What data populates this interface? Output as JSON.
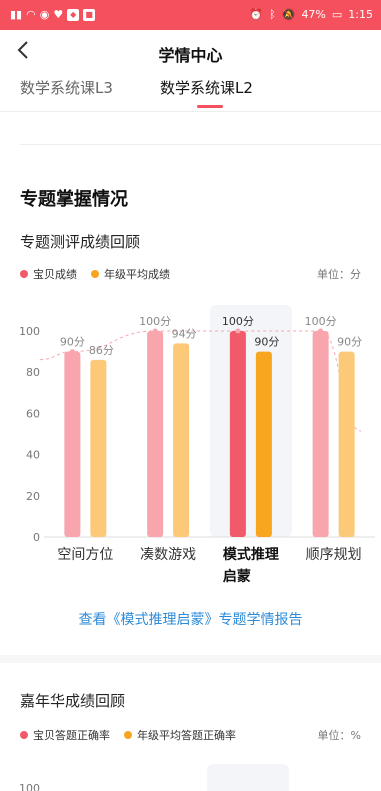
{
  "status": {
    "battery": "47%",
    "time": "1:15"
  },
  "header": {
    "title": "学情中心",
    "tabs": [
      "数学系统课L3",
      "数学系统课L2"
    ],
    "active_tab": 1
  },
  "section": {
    "title": "专题掌握情况"
  },
  "review1": {
    "title": "专题测评成绩回顾",
    "legend": [
      "宝贝成绩",
      "年级平均成绩"
    ],
    "unit": "单位：分",
    "link": "查看《模式推理启蒙》专题学情报告"
  },
  "review2": {
    "title": "嘉年华成绩回顾",
    "legend": [
      "宝贝答题正确率",
      "年级平均答题正确率"
    ],
    "unit": "单位：%"
  },
  "colors": {
    "accent": "#f4505e",
    "baby_light": "#f8a5ad",
    "baby_selected": "#f05a69",
    "avg_light": "#fcc979",
    "avg_selected": "#f8a51f",
    "link": "#2e8bd8"
  },
  "chart_data": [
    {
      "type": "bar",
      "title": "专题测评成绩回顾",
      "categories": [
        "空间方位",
        "凑数游戏",
        "模式推理启蒙",
        "顺序规划"
      ],
      "series": [
        {
          "name": "宝贝成绩",
          "values": [
            90,
            100,
            100,
            100
          ]
        },
        {
          "name": "年级平均成绩",
          "values": [
            86,
            94,
            90,
            90
          ]
        }
      ],
      "data_labels": [
        [
          "90分",
          "86分"
        ],
        [
          "100分",
          "94分"
        ],
        [
          "100分",
          "90分"
        ],
        [
          "100分",
          "90分"
        ]
      ],
      "y_ticks": [
        0,
        20,
        40,
        60,
        80,
        100
      ],
      "ylim": [
        0,
        100
      ],
      "highlighted_category": "模式推理启蒙",
      "legend_position": "top-left"
    },
    {
      "type": "bar",
      "title": "嘉年华成绩回顾",
      "series": [
        {
          "name": "宝贝答题正确率",
          "values": []
        },
        {
          "name": "年级平均答题正确率",
          "values": []
        }
      ],
      "y_ticks": [
        100
      ],
      "legend_position": "top-left"
    }
  ]
}
